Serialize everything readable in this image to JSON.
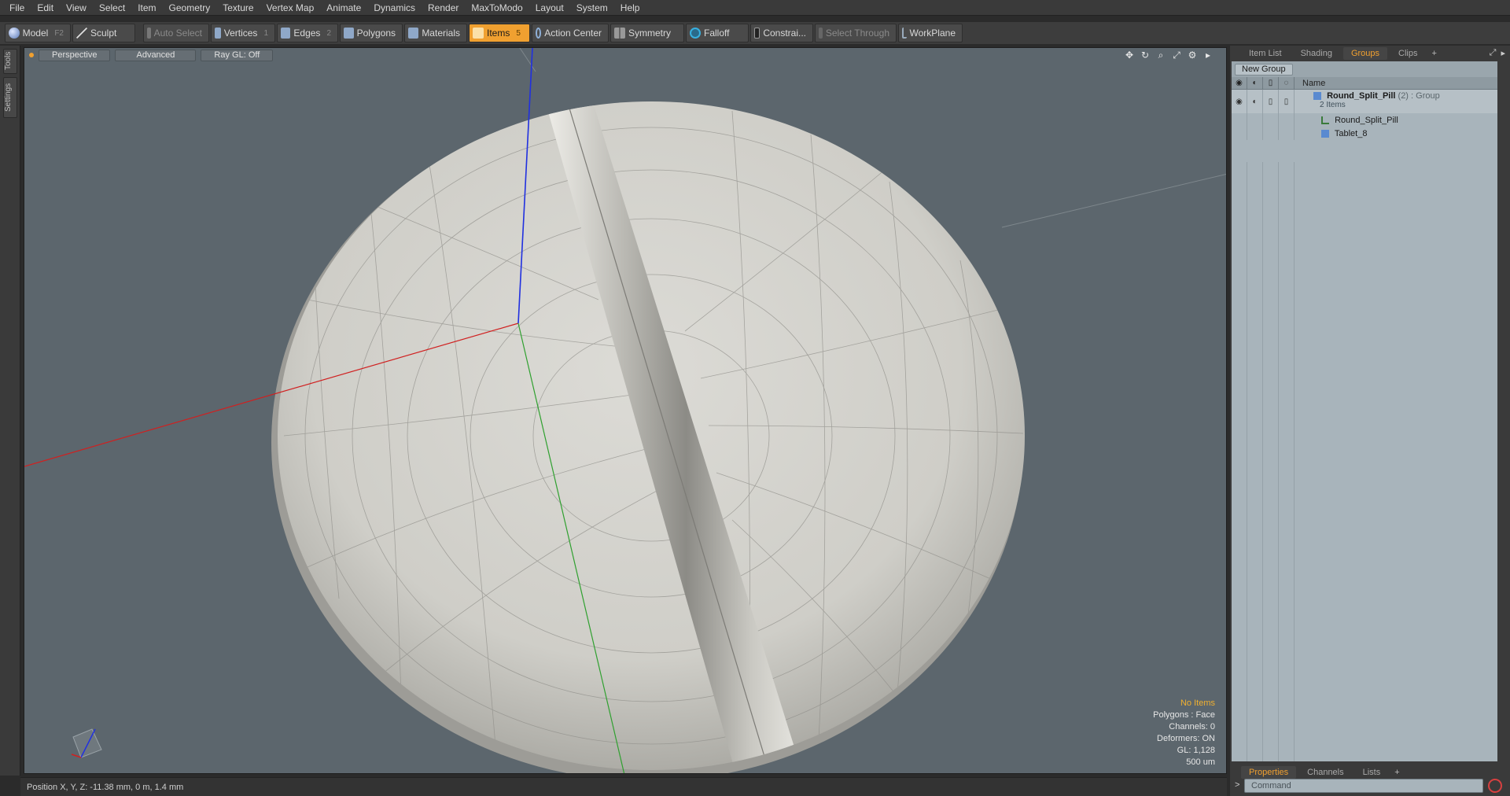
{
  "menu": [
    "File",
    "Edit",
    "View",
    "Select",
    "Item",
    "Geometry",
    "Texture",
    "Vertex Map",
    "Animate",
    "Dynamics",
    "Render",
    "MaxToModo",
    "Layout",
    "System",
    "Help"
  ],
  "toolbar": {
    "model": "Model",
    "model_key": "F2",
    "sculpt": "Sculpt",
    "auto_select": "Auto Select",
    "vertices": "Vertices",
    "vertices_key": "1",
    "edges": "Edges",
    "edges_key": "2",
    "polygons": "Polygons",
    "materials": "Materials",
    "items": "Items",
    "items_key": "5",
    "action_center": "Action Center",
    "symmetry": "Symmetry",
    "falloff": "Falloff",
    "constraints": "Constrai...",
    "select_through": "Select Through",
    "workplane": "WorkPlane"
  },
  "left_tabs": {
    "tools": "Tools",
    "settings": "Settings"
  },
  "viewport": {
    "view_mode": "Perspective",
    "advanced": "Advanced",
    "raygl": "Ray GL: Off",
    "info": {
      "selection": "No Items",
      "polygons": "Polygons : Face",
      "channels": "Channels: 0",
      "deformers": "Deformers: ON",
      "gl": "GL: 1,128",
      "scale": "500 um"
    }
  },
  "status": {
    "position": "Position X, Y, Z:  -11.38 mm, 0 m, 1.4 mm"
  },
  "right_panel": {
    "tabs": [
      "Item List",
      "Shading",
      "Groups",
      "Clips"
    ],
    "active_tab": "Groups",
    "new_group": "New Group",
    "name_header": "Name",
    "group": {
      "name": "Round_Split_Pill",
      "count": "(2)",
      "type": ": Group",
      "items_label": "2 Items"
    },
    "children": [
      "Round_Split_Pill",
      "Tablet_8"
    ],
    "bottom_tabs": [
      "Properties",
      "Channels",
      "Lists"
    ],
    "command_placeholder": "Command"
  },
  "colors": {
    "accent": "#f0a030",
    "viewport_bg": "#5c666d",
    "panel_bg": "#a8b4bb",
    "axis_x": "#d02020",
    "axis_y": "#2fa02f",
    "axis_z": "#2030e0"
  },
  "icons": {
    "transform": "move-icon",
    "rotate": "rotate-icon",
    "zoom": "zoom-icon",
    "maximize": "maximize-icon",
    "settings": "gear-icon"
  }
}
